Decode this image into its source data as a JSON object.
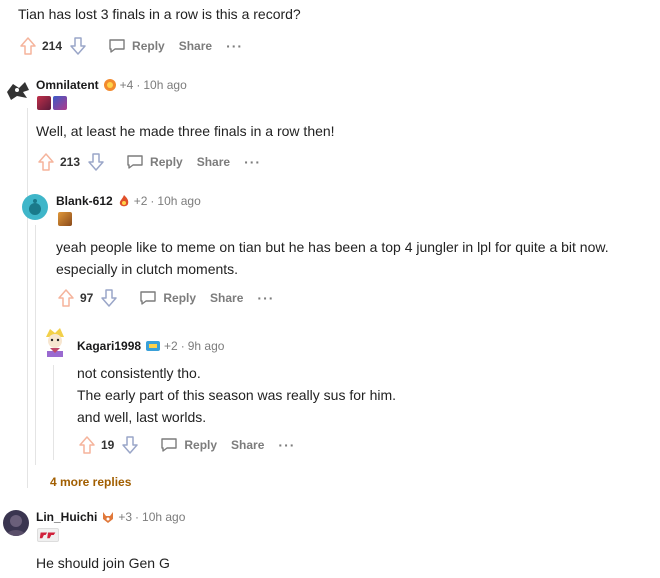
{
  "top": {
    "text": "Tian has lost 3 finals in a row is this a record?",
    "votes": "214"
  },
  "comments": [
    {
      "user": "Omnilatent",
      "score": "+4",
      "time": "10h ago",
      "text": "Well, at least he made three finals in a row then!",
      "votes": "213"
    },
    {
      "user": "Blank-612",
      "score": "+2",
      "time": "10h ago",
      "text_lines": [
        "yeah people like to meme on tian but he has been a top 4 jungler in lpl for quite a bit now.",
        "especially in clutch moments."
      ],
      "votes": "97"
    },
    {
      "user": "Kagari1998",
      "score": "+2",
      "time": "9h ago",
      "text_lines": [
        "not consistently tho.",
        "The early part of this season was really sus for him.",
        "and well, last worlds."
      ],
      "votes": "19"
    },
    {
      "user": "Lin_Huichi",
      "score": "+3",
      "time": "10h ago",
      "text": "He should join Gen G"
    }
  ],
  "labels": {
    "reply": "Reply",
    "share": "Share",
    "more": "···",
    "dot": "·",
    "more_replies": "4 more replies"
  },
  "icons": {
    "upvote": "upvote-arrow-icon",
    "downvote": "downvote-arrow-icon",
    "reply": "speech-bubble-icon",
    "more": "ellipsis-icon"
  },
  "colors": {
    "upvote": "#f5b49c",
    "downvote": "#9aa6c8",
    "more_replies": "#a15e00"
  }
}
